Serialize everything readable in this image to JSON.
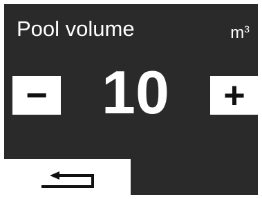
{
  "screen": {
    "title": "Pool volume",
    "unit_base": "m",
    "unit_exponent": "3",
    "value": "10",
    "decrement_label": "−",
    "increment_label": "+",
    "back_icon": "return-arrow-icon"
  },
  "colors": {
    "screen_background": "#2a2a2a",
    "text": "#ffffff",
    "button_background": "#ffffff",
    "button_glyph": "#111111"
  }
}
